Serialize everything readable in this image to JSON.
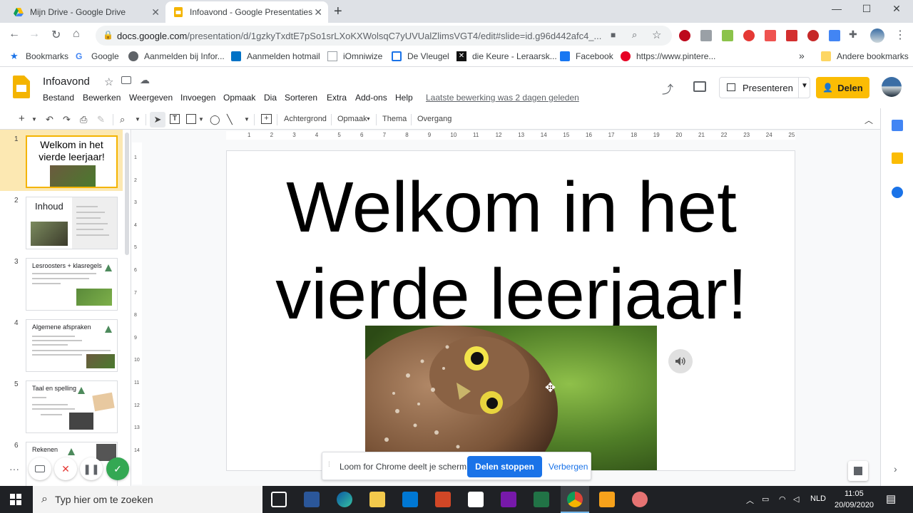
{
  "browser": {
    "tabs": [
      {
        "title": "Mijn Drive - Google Drive",
        "active": false
      },
      {
        "title": "Infoavond - Google Presentaties",
        "active": true
      }
    ],
    "new_tab": "+",
    "window_controls": {
      "minimize": "—",
      "maximize": "☐",
      "close": "✕"
    },
    "url_host": "docs.google.com",
    "url_path": "/presentation/d/1gzkyTxdtE7pSo1srLXoKXWolsqC7yUVUalZlimsVGT4/edit#slide=id.g96d442afc4_...",
    "bookmarks": [
      {
        "label": "Bookmarks",
        "icon": "star-icon"
      },
      {
        "label": "Google",
        "icon": "google-icon"
      },
      {
        "label": "Aanmelden bij Infor...",
        "icon": "globe-icon"
      },
      {
        "label": "Aanmelden hotmail",
        "icon": "outlook-icon"
      },
      {
        "label": "iOmniwize",
        "icon": "page-icon"
      },
      {
        "label": "De Vleugel",
        "icon": "calendar-icon"
      },
      {
        "label": "die Keure - Leraarsk...",
        "icon": "x-icon"
      },
      {
        "label": "Facebook",
        "icon": "facebook-icon"
      },
      {
        "label": "https://www.pintere...",
        "icon": "pinterest-icon"
      }
    ],
    "bookmarks_overflow": "»",
    "other_bookmarks": "Andere bookmarks"
  },
  "app": {
    "doc_title": "Infoavond",
    "menus": [
      "Bestand",
      "Bewerken",
      "Weergeven",
      "Invoegen",
      "Opmaak",
      "Dia",
      "Sorteren",
      "Extra",
      "Add-ons",
      "Help"
    ],
    "last_edit": "Laatste bewerking was 2 dagen geleden",
    "present_label": "Presenteren",
    "share_label": "Delen",
    "toolbar_text": {
      "background": "Achtergrond",
      "format": "Opmaak",
      "theme": "Thema",
      "transition": "Overgang"
    },
    "ruler_marks": [
      "1",
      "2",
      "3",
      "4",
      "5",
      "6",
      "7",
      "8",
      "9",
      "10",
      "11",
      "12",
      "13",
      "14",
      "15",
      "16",
      "17",
      "18",
      "19",
      "20",
      "21",
      "22",
      "23",
      "24",
      "25"
    ],
    "ruler_v_marks": [
      "1",
      "2",
      "3",
      "4",
      "5",
      "6",
      "7",
      "8",
      "9",
      "10",
      "11",
      "12",
      "13",
      "14"
    ]
  },
  "slides": [
    {
      "num": "1",
      "title": "Welkom in het vierde leerjaar!",
      "selected": true
    },
    {
      "num": "2",
      "title": "Inhoud",
      "selected": false
    },
    {
      "num": "3",
      "title": "Lesroosters + klasregels",
      "selected": false
    },
    {
      "num": "4",
      "title": "Algemene afspraken",
      "selected": false
    },
    {
      "num": "5",
      "title": "Taal en spelling",
      "selected": false
    },
    {
      "num": "6",
      "title": "Rekenen",
      "selected": false
    }
  ],
  "slide": {
    "title_line1": "Welkom in het",
    "title_line2": "vierde leerjaar!"
  },
  "loom": {
    "message": "Loom for Chrome deelt je scherm.",
    "stop": "Delen stoppen",
    "hide": "Verbergen"
  },
  "taskbar": {
    "search_placeholder": "Typ hier om te zoeken",
    "language": "NLD",
    "time": "11:05",
    "date": "20/09/2020"
  },
  "colors": {
    "accent_yellow": "#fbbc04",
    "selection": "#fce8b2",
    "loom_blue": "#1a73e8"
  }
}
